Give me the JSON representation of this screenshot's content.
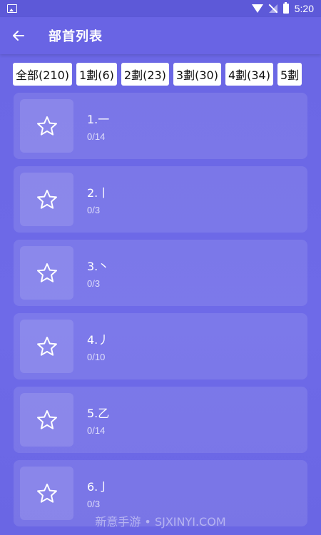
{
  "status_bar": {
    "time": "5:20",
    "icons": [
      "gallery-icon",
      "wifi-icon",
      "no-signal-icon",
      "battery-icon"
    ]
  },
  "app_bar": {
    "title": "部首列表",
    "back_icon": "arrow-left-icon"
  },
  "filters": [
    {
      "label": "全部(210)"
    },
    {
      "label": "1劃(6)"
    },
    {
      "label": "2劃(23)"
    },
    {
      "label": "3劃(30)"
    },
    {
      "label": "4劃(34)"
    },
    {
      "label": "5劃"
    }
  ],
  "radicals": [
    {
      "title": "1.一",
      "count": "0/14",
      "icon": "star-outline-icon"
    },
    {
      "title": "2.丨",
      "count": "0/3",
      "icon": "star-outline-icon"
    },
    {
      "title": "3.丶",
      "count": "0/3",
      "icon": "star-outline-icon"
    },
    {
      "title": "4.丿",
      "count": "0/10",
      "icon": "star-outline-icon"
    },
    {
      "title": "5.乙",
      "count": "0/14",
      "icon": "star-outline-icon"
    },
    {
      "title": "6.亅",
      "count": "0/3",
      "icon": "star-outline-icon"
    }
  ],
  "watermark": "新意手游 • SJXINYI.COM",
  "colors": {
    "background": "#6a66e4",
    "app_bar": "#6964e4",
    "chip": "#ffffff",
    "text": "#ffffff"
  }
}
